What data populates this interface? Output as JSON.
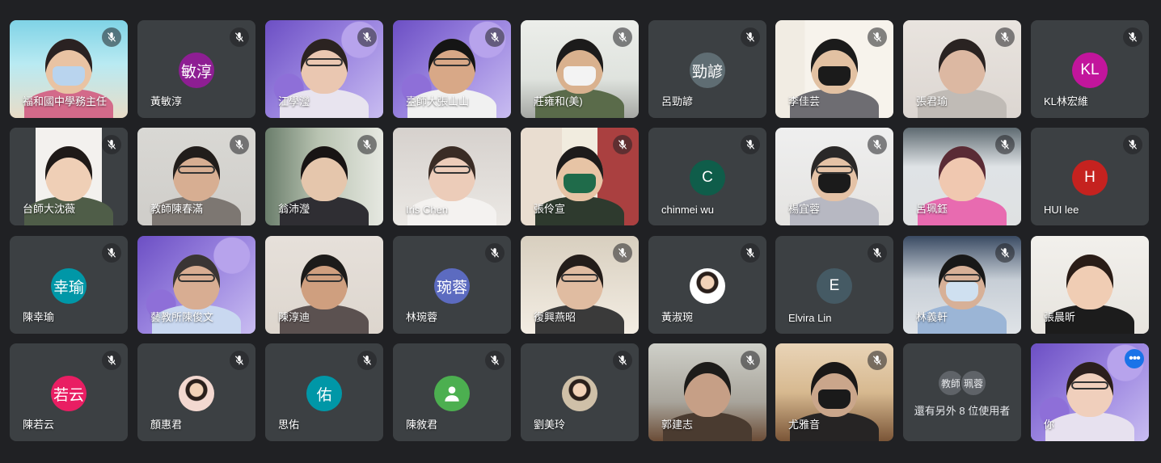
{
  "tiles": [
    {
      "name": "福和國中學務主任",
      "kind": "video",
      "bg": "linear-gradient(180deg,#7fd3e6 0%,#b9eaf2 45%,#e9dcc7 100%)",
      "skin": "#e9c3a3",
      "hair": "#2a2222",
      "shirt": "#d36a8a",
      "mask": "#b9d4ee",
      "glasses": false,
      "muted": true
    },
    {
      "name": "黃敏淳",
      "kind": "avatar",
      "initials": "敏淳",
      "color": "#8e1e93",
      "muted": true
    },
    {
      "name": "江學瀅",
      "kind": "video",
      "bg": "purple",
      "skin": "#eac7b1",
      "hair": "#2b2321",
      "shirt": "#e8e4ef",
      "glasses": true,
      "muted": true
    },
    {
      "name": "臺師大張山山",
      "kind": "video",
      "bg": "purple",
      "skin": "#d8a887",
      "hair": "#151515",
      "shirt": "#f1f1f1",
      "glasses": true,
      "muted": true
    },
    {
      "name": "莊雍和(美)",
      "kind": "video",
      "bg": "linear-gradient(180deg,#eceeea 0%,#dfe3de 60%,#a5a7a3 100%)",
      "skin": "#d9b18e",
      "hair": "#1c1b1b",
      "shirt": "#5a6b4a",
      "mask": "#f3f3f3",
      "glasses": false,
      "muted": true
    },
    {
      "name": "呂勁諺",
      "kind": "avatar",
      "initials": "勁諺",
      "color": "#5f6d73",
      "muted": true
    },
    {
      "name": "李佳芸",
      "kind": "video",
      "bg": "linear-gradient(90deg,#f1ece3 0 25%,#f7f3ec 25% 100%)",
      "skin": "#e2c1a2",
      "hair": "#1b1b1b",
      "shirt": "#6e6d72",
      "mask": "#1b1b1b",
      "glasses": false,
      "muted": true
    },
    {
      "name": "張君瑜",
      "kind": "video",
      "bg": "linear-gradient(180deg,#e9e4df 0%,#dcd6d1 100%)",
      "skin": "#dcb8a2",
      "hair": "#2a2322",
      "shirt": "#c0bbb6",
      "glasses": false,
      "muted": true
    },
    {
      "name": "KL林宏維",
      "kind": "avatar",
      "initials": "KL",
      "color": "#c2159c",
      "muted": true
    },
    {
      "name": "台師大沈薇",
      "kind": "video",
      "bg": "linear-gradient(90deg,#3c4043 0 22%,#f3f1ee 22% 78%,#3c4043 78%)",
      "skin": "#efcfb6",
      "hair": "#1f1a18",
      "shirt": "#4f5d48",
      "glasses": false,
      "muted": true
    },
    {
      "name": "教師陳春滿",
      "kind": "video",
      "bg": "linear-gradient(180deg,#d9d8d4 0%,#cfcdc9 100%)",
      "skin": "#d7ae92",
      "hair": "#211d1b",
      "shirt": "#7d7772",
      "glasses": true,
      "muted": true
    },
    {
      "name": "翁沛瀅",
      "kind": "video",
      "bg": "linear-gradient(90deg,#6a7d6b 0%,#b8c3b1 45%,#e6e8e1 100%)",
      "skin": "#e5c6ac",
      "hair": "#181414",
      "shirt": "#2f2e33",
      "glasses": false,
      "muted": true
    },
    {
      "name": "Iris Chen",
      "kind": "video",
      "bg": "linear-gradient(180deg,#d6d1cd 0%,#ebe8e4 100%)",
      "skin": "#ecccb9",
      "hair": "#3a2c25",
      "shirt": "#f4f2f0",
      "glasses": true,
      "muted": false
    },
    {
      "name": "張伶宣",
      "kind": "video",
      "bg": "linear-gradient(90deg,#e9ddd0 0 35%,#f1ecdf 35% 65%,#aa4040 65%)",
      "skin": "#e7c4a5",
      "hair": "#1d1b1b",
      "shirt": "#2e3a2e",
      "mask": "#1f6b4a",
      "glasses": false,
      "muted": true
    },
    {
      "name": "chinmei wu",
      "kind": "avatar",
      "initials": "C",
      "color": "#0f5d4a",
      "muted": true
    },
    {
      "name": "楊宜蓉",
      "kind": "video",
      "bg": "linear-gradient(180deg,#efefef 0%,#e4e3e1 100%)",
      "skin": "#e4c2a6",
      "hair": "#2a2828",
      "shirt": "#b7b8c2",
      "mask": "#1b1b1b",
      "glasses": true,
      "muted": true
    },
    {
      "name": "呂珮鈺",
      "kind": "video",
      "bg": "linear-gradient(180deg,#5e6a71 0%,#dfe3e6 40%,#dfe1e2 100%)",
      "skin": "#f0c8b0",
      "hair": "#5a2b35",
      "shirt": "#e86bb0",
      "glasses": false,
      "muted": true
    },
    {
      "name": "HUI lee",
      "kind": "avatar",
      "initials": "H",
      "color": "#c5221f",
      "muted": true
    },
    {
      "name": "陳幸瑜",
      "kind": "avatar",
      "initials": "幸瑜",
      "color": "#0097a7",
      "muted": true
    },
    {
      "name": "藝教所陳俊文",
      "kind": "video",
      "bg": "purple",
      "skin": "#d8ad92",
      "hair": "#3a3534",
      "shirt": "#c9d8f0",
      "glasses": true,
      "muted": false
    },
    {
      "name": "陳淳迪",
      "kind": "video",
      "bg": "linear-gradient(180deg,#e6e0da 0%,#ddd6ce 100%)",
      "skin": "#cf9f7f",
      "hair": "#1c1b1a",
      "shirt": "#5b5150",
      "glasses": true,
      "muted": false
    },
    {
      "name": "林琬蓉",
      "kind": "avatar",
      "initials": "琬蓉",
      "color": "#5c6bc0",
      "muted": true
    },
    {
      "name": "復興燕昭",
      "kind": "video",
      "bg": "linear-gradient(180deg,#d8cfbf 0%,#f3ede3 100%)",
      "skin": "#e0bca1",
      "hair": "#231d1a",
      "shirt": "#3a3a3a",
      "glasses": true,
      "muted": true
    },
    {
      "name": "黃淑琬",
      "kind": "avatar-photo",
      "initials": "",
      "color": "#ffffff",
      "muted": true
    },
    {
      "name": "Elvira Lin",
      "kind": "avatar",
      "initials": "E",
      "color": "#455a64",
      "muted": true
    },
    {
      "name": "林義軒",
      "kind": "video",
      "bg": "linear-gradient(180deg,#3a4b63 0%,#c7ced6 45%,#dfe3e7 100%)",
      "skin": "#d7b097",
      "hair": "#181818",
      "shirt": "#9bb5d6",
      "mask": "#cfe0f0",
      "glasses": true,
      "muted": true
    },
    {
      "name": "張晨昕",
      "kind": "video",
      "bg": "linear-gradient(180deg,#f2f0ec 0%,#e7e4de 100%)",
      "skin": "#f0cdb4",
      "hair": "#2a1d17",
      "shirt": "#1c1c1c",
      "glasses": false,
      "muted": false
    },
    {
      "name": "陳若云",
      "kind": "avatar",
      "initials": "若云",
      "color": "#e91e63",
      "muted": true
    },
    {
      "name": "顏惠君",
      "kind": "avatar-photo",
      "initials": "",
      "color": "#f3d8d0",
      "muted": true
    },
    {
      "name": "思佑",
      "kind": "avatar",
      "initials": "佑",
      "color": "#0097a7",
      "muted": true
    },
    {
      "name": "陳敘君",
      "kind": "avatar-generic",
      "initials": "",
      "color": "#4caf50",
      "muted": true
    },
    {
      "name": "劉美玲",
      "kind": "avatar-photo",
      "initials": "",
      "color": "#cfc0a8",
      "muted": true
    },
    {
      "name": "郭建志",
      "kind": "video",
      "bg": "linear-gradient(180deg,#cfd0c9 0%,#a8a49b 60%,#6b4c36 100%)",
      "skin": "#c69f86",
      "hair": "#1d1c1a",
      "shirt": "#4a3b30",
      "glasses": false,
      "muted": true
    },
    {
      "name": "尤雅音",
      "kind": "video",
      "bg": "linear-gradient(180deg,#e9d4b7 0%,#d7b990 50%,#7a5537 100%)",
      "skin": "#caa68b",
      "hair": "#1a1817",
      "shirt": "#262424",
      "mask": "#1a1a1a",
      "glasses": false,
      "muted": true
    },
    {
      "name": "還有另外 8 位使用者",
      "kind": "more",
      "others": [
        "教師",
        "珮蓉"
      ],
      "muted": false
    },
    {
      "name": "你",
      "kind": "video",
      "bg": "purple",
      "skin": "#f0cfbc",
      "hair": "#2b1f1d",
      "shirt": "#e7e1ef",
      "glasses": true,
      "muted": false,
      "self": true
    }
  ],
  "icons": {
    "mic_off": "mic-off-icon",
    "more": "more-options-icon"
  },
  "more_label": "•••"
}
